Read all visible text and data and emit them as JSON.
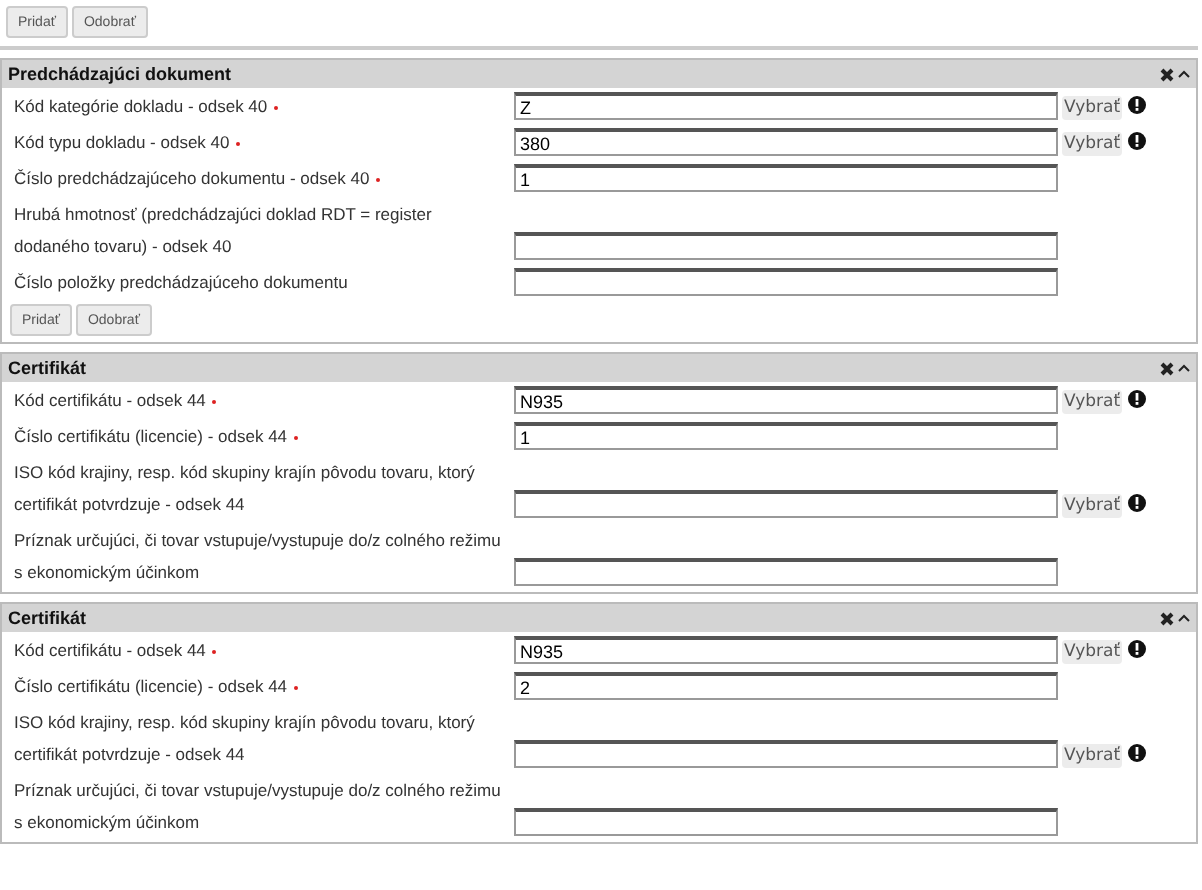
{
  "toolbar": {
    "buttons": [
      "Pridať",
      "Odobrať"
    ]
  },
  "sections": [
    {
      "title": "Predchádzajúci dokument",
      "fields": [
        {
          "label": "Kód kategórie dokladu - odsek 40",
          "required": true,
          "value": "Z",
          "picker": "Vybrať"
        },
        {
          "label": "Kód typu dokladu - odsek 40",
          "required": true,
          "value": "380",
          "picker": "Vybrať"
        },
        {
          "label": "Číslo predchádzajúceho dokumentu - odsek 40",
          "required": true,
          "value": "1"
        },
        {
          "label": "Hrubá hmotnosť (predchádzajúci doklad RDT = register dodaného tovaru) - odsek 40",
          "required": false
        },
        {
          "label": "Číslo položky predchádzajúceho dokumentu",
          "required": false
        }
      ],
      "buttons": [
        "Pridať",
        "Odobrať"
      ]
    },
    {
      "title": "Certifikát",
      "fields": [
        {
          "label": "Kód certifikátu - odsek 44",
          "required": true,
          "value": "N935",
          "picker": "Vybrať"
        },
        {
          "label": "Číslo certifikátu (licencie) - odsek 44",
          "required": true,
          "value": "1"
        },
        {
          "label": "ISO kód krajiny, resp. kód skupiny krajín pôvodu tovaru, ktorý certifikát potvrdzuje - odsek 44",
          "required": false,
          "picker": "Vybrať"
        },
        {
          "label": "Príznak určujúci, či tovar vstupuje/vystupuje do/z colného režimu s ekonomickým účinkom",
          "required": false
        }
      ]
    },
    {
      "title": "Certifikát",
      "fields": [
        {
          "label": "Kód certifikátu - odsek 44",
          "required": true,
          "value": "N935",
          "picker": "Vybrať"
        },
        {
          "label": "Číslo certifikátu (licencie) - odsek 44",
          "required": true,
          "value": "2"
        },
        {
          "label": "ISO kód krajiny, resp. kód skupiny krajín pôvodu tovaru, ktorý certifikát potvrdzuje - odsek 44",
          "required": false,
          "picker": "Vybrať"
        },
        {
          "label": "Príznak určujúci, či tovar vstupuje/vystupuje do/z colného režimu s ekonomickým účinkom",
          "required": false
        }
      ]
    }
  ]
}
